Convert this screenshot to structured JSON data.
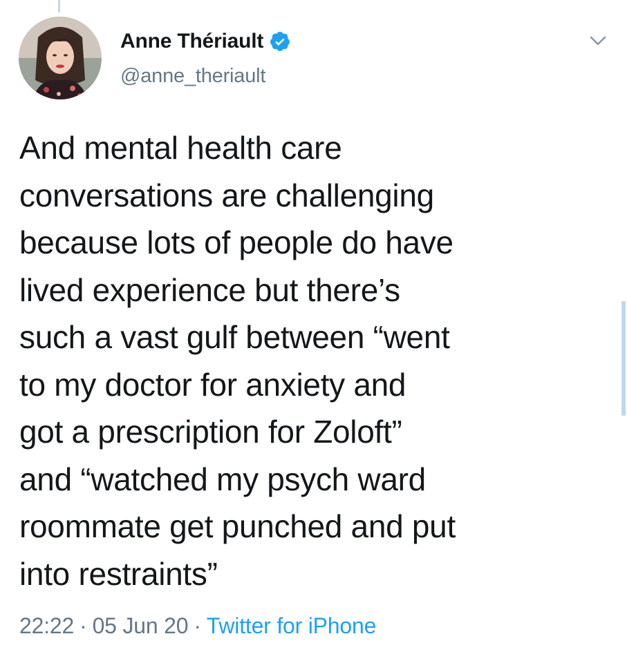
{
  "author": {
    "display_name": "Anne Thériault",
    "handle": "@anne_theriault",
    "verified": true
  },
  "tweet": {
    "lines": [
      "And mental health care",
      "conversations are challenging",
      "because lots of people do have",
      "lived experience but there’s",
      "such a vast gulf between “went",
      "to my doctor for anxiety and",
      "got a prescription for Zoloft”",
      "and “watched my psych ward",
      "roommate get punched and put",
      "into restraints”"
    ]
  },
  "meta": {
    "time": "22:22",
    "separator": "·",
    "date": "05 Jun 20",
    "source": "Twitter for iPhone"
  },
  "icons": {
    "verified": "verified-badge-icon",
    "menu": "chevron-down-icon"
  },
  "colors": {
    "primary_text": "#14171a",
    "secondary_text": "#657786",
    "accent": "#1da1f2",
    "scroll_indicator": "#bcd9f2"
  }
}
